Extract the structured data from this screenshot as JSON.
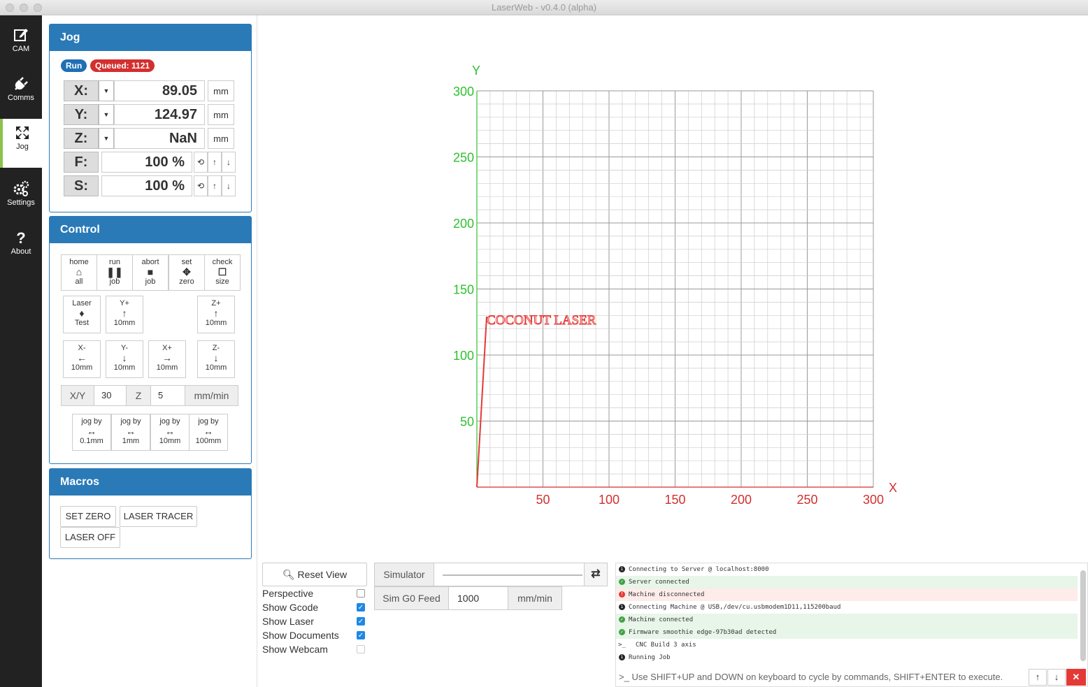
{
  "window": {
    "title": "LaserWeb - v0.4.0 (alpha)"
  },
  "sidebar": {
    "items": [
      {
        "label": "CAM",
        "icon": "edit-icon"
      },
      {
        "label": "Comms",
        "icon": "plug-icon"
      },
      {
        "label": "Jog",
        "icon": "move-icon",
        "active": true
      },
      {
        "label": "Settings",
        "icon": "gears-icon"
      },
      {
        "label": "About",
        "icon": "question-icon"
      }
    ]
  },
  "jog": {
    "title": "Jog",
    "run_badge": "Run",
    "queued_badge": "Queued: 1121",
    "axes": [
      {
        "label": "X:",
        "value": "89.05",
        "unit": "mm"
      },
      {
        "label": "Y:",
        "value": "124.97",
        "unit": "mm"
      },
      {
        "label": "Z:",
        "value": "NaN",
        "unit": "mm"
      }
    ],
    "overrides": [
      {
        "label": "F:",
        "value": "100 %"
      },
      {
        "label": "S:",
        "value": "100 %"
      }
    ]
  },
  "control": {
    "title": "Control",
    "top_buttons": [
      {
        "top": "home",
        "glyph": "⌂",
        "bottom": "all"
      },
      {
        "top": "run",
        "glyph": "❚❚",
        "bottom": "job"
      },
      {
        "top": "abort",
        "glyph": "■",
        "bottom": "job"
      },
      {
        "top": "set",
        "glyph": "✥",
        "bottom": "zero"
      },
      {
        "top": "check",
        "glyph": "☐",
        "bottom": "size"
      }
    ],
    "laser_test": {
      "top": "Laser",
      "glyph": "♦",
      "bottom": "Test"
    },
    "y_plus": {
      "top": "Y+",
      "glyph": "↑",
      "bottom": "10mm"
    },
    "z_plus": {
      "top": "Z+",
      "glyph": "↑",
      "bottom": "10mm"
    },
    "x_minus": {
      "top": "X-",
      "glyph": "←",
      "bottom": "10mm"
    },
    "y_minus": {
      "top": "Y-",
      "glyph": "↓",
      "bottom": "10mm"
    },
    "x_plus": {
      "top": "X+",
      "glyph": "→",
      "bottom": "10mm"
    },
    "z_minus": {
      "top": "Z-",
      "glyph": "↓",
      "bottom": "10mm"
    },
    "feed": {
      "xy_label": "X/Y",
      "xy_value": "30",
      "z_label": "Z",
      "z_value": "5",
      "unit": "mm/min"
    },
    "jog_steps": [
      {
        "top": "jog by",
        "glyph": "↔",
        "bottom": "0.1mm"
      },
      {
        "top": "jog by",
        "glyph": "↔",
        "bottom": "1mm"
      },
      {
        "top": "jog by",
        "glyph": "↔",
        "bottom": "10mm"
      },
      {
        "top": "jog by",
        "glyph": "↔",
        "bottom": "100mm"
      }
    ]
  },
  "macros": {
    "title": "Macros",
    "buttons": [
      "SET ZERO",
      "LASER TRACER",
      "LASER OFF"
    ]
  },
  "viewer": {
    "x_axis_label": "X",
    "y_axis_label": "Y",
    "x_ticks": [
      "50",
      "100",
      "150",
      "200",
      "250",
      "300"
    ],
    "y_ticks": [
      "50",
      "100",
      "150",
      "200",
      "250",
      "300"
    ],
    "bed_size_mm": [
      300,
      300
    ],
    "text_label": "COCONUT LASER",
    "colors": {
      "x_axis": "#d32f2f",
      "y_axis": "#2ec12e",
      "grid": "#cccccc"
    }
  },
  "view_controls": {
    "reset_label": "Reset View",
    "options": [
      {
        "label": "Perspective",
        "checked": false
      },
      {
        "label": "Show Gcode",
        "checked": true
      },
      {
        "label": "Show Laser",
        "checked": true
      },
      {
        "label": "Show Documents",
        "checked": true
      },
      {
        "label": "Show Webcam",
        "checked": false
      }
    ]
  },
  "simulator": {
    "label": "Simulator",
    "feed_label": "Sim G0 Feed",
    "feed_value": "1000",
    "feed_unit": "mm/min"
  },
  "console": {
    "lines": [
      {
        "text": "Connecting to Server @ localhost:8000",
        "type": "info"
      },
      {
        "text": "Server connected",
        "type": "success"
      },
      {
        "text": "Machine disconnected",
        "type": "error"
      },
      {
        "text": "Connecting Machine @ USB,/dev/cu.usbmodem1D11,115200baud",
        "type": "info"
      },
      {
        "text": "Machine connected",
        "type": "success"
      },
      {
        "text": "Firmware smoothie edge-97b30ad detected",
        "type": "success"
      },
      {
        "text": "CNC Build 3 axis",
        "type": "prompt"
      },
      {
        "text": "Running Job",
        "type": "info"
      }
    ],
    "placeholder": "Use SHIFT+UP and DOWN on keyboard to cycle by commands, SHIFT+ENTER to execute."
  }
}
